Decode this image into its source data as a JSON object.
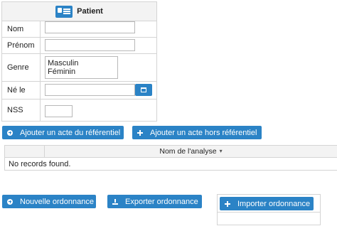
{
  "patient": {
    "title": "Patient",
    "icon": "patient-card-icon",
    "fields": {
      "nom": {
        "label": "Nom",
        "value": ""
      },
      "prenom": {
        "label": "Prénom",
        "value": ""
      },
      "genre": {
        "label": "Genre",
        "options": [
          "Masculin",
          "Féminin"
        ]
      },
      "ne_le": {
        "label": "Né le",
        "value": "",
        "button_icon": "calendar-icon"
      },
      "nss": {
        "label": "NSS",
        "value": ""
      }
    }
  },
  "actions": {
    "add_referentiel": "Ajouter un acte du référentiel",
    "add_hors_referentiel": "Ajouter un acte hors référentiel"
  },
  "analysis_grid": {
    "column": "Nom de l'analyse",
    "sort_icon": "sort-icon",
    "empty_message": "No records found."
  },
  "ordonnance": {
    "new": "Nouvelle ordonnance",
    "export": "Exporter ordonnance",
    "import": "Importer ordonnance"
  },
  "colors": {
    "primary": "#2b83c6",
    "header_bg": "#f3f3f3",
    "border": "#d4d4d4"
  }
}
